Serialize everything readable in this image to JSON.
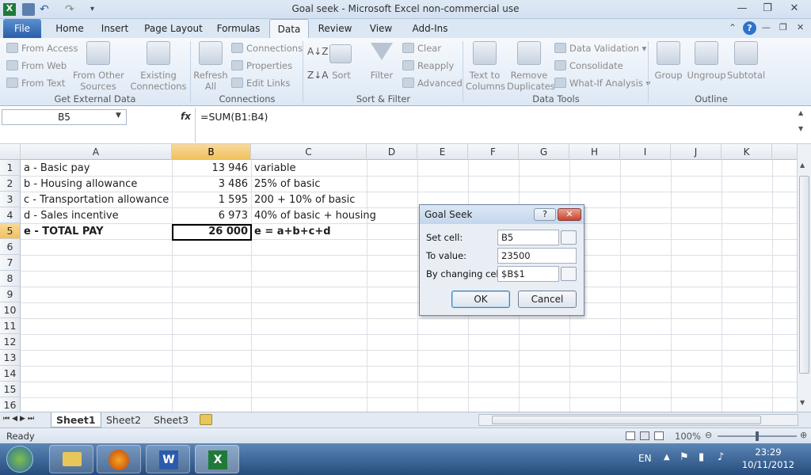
{
  "window": {
    "title": "Goal seek  -  Microsoft Excel non-commercial use"
  },
  "tabs": [
    "File",
    "Home",
    "Insert",
    "Page Layout",
    "Formulas",
    "Data",
    "Review",
    "View",
    "Add-Ins"
  ],
  "ribbon": {
    "get_external": {
      "from_access": "From Access",
      "from_web": "From Web",
      "from_text": "From Text",
      "from_other_1": "From Other",
      "from_other_2": "Sources",
      "existing_1": "Existing",
      "existing_2": "Connections",
      "group": "Get External Data"
    },
    "connections": {
      "refresh_1": "Refresh",
      "refresh_2": "All",
      "connections": "Connections",
      "properties": "Properties",
      "edit_links": "Edit Links",
      "group": "Connections"
    },
    "sort_filter": {
      "sort": "Sort",
      "filter": "Filter",
      "clear": "Clear",
      "reapply": "Reapply",
      "advanced": "Advanced",
      "group": "Sort & Filter"
    },
    "data_tools": {
      "ttc_1": "Text to",
      "ttc_2": "Columns",
      "rd_1": "Remove",
      "rd_2": "Duplicates",
      "validation": "Data Validation",
      "consolidate": "Consolidate",
      "whatif": "What-If Analysis",
      "group": "Data Tools"
    },
    "outline": {
      "group_btn": "Group",
      "ungroup": "Ungroup",
      "subtotal": "Subtotal",
      "group": "Outline"
    }
  },
  "formula_bar": {
    "name_box": "B5",
    "fx": "fx",
    "formula": "=SUM(B1:B4)"
  },
  "columns": [
    "A",
    "B",
    "C",
    "D",
    "E",
    "F",
    "G",
    "H",
    "I",
    "J",
    "K"
  ],
  "rows": [
    "1",
    "2",
    "3",
    "4",
    "5",
    "6",
    "7",
    "8",
    "9",
    "10",
    "11",
    "12",
    "13",
    "14",
    "15",
    "16"
  ],
  "cells": [
    {
      "a": "a - Basic pay",
      "b": "13 946",
      "c": "variable"
    },
    {
      "a": "b - Housing allowance",
      "b": "3 486",
      "c": "25% of basic"
    },
    {
      "a": "c - Transportation allowance",
      "b": "1 595",
      "c": "200 + 10% of basic"
    },
    {
      "a": "d - Sales incentive",
      "b": "6 973",
      "c": "40% of basic + housing"
    },
    {
      "a": "e - TOTAL PAY",
      "b": "26 000",
      "c": "e = a+b+c+d"
    }
  ],
  "sheets": [
    "Sheet1",
    "Sheet2",
    "Sheet3"
  ],
  "status": {
    "ready": "Ready",
    "zoom": "100%"
  },
  "dialog": {
    "title": "Goal Seek",
    "set_cell_label": "Set cell:",
    "set_cell_value": "B5",
    "to_value_label": "To value:",
    "to_value_value": "23500",
    "changing_label": "By changing cell:",
    "changing_value": "$B$1",
    "ok": "OK",
    "cancel": "Cancel",
    "help": "?",
    "close": "✕"
  },
  "taskbar": {
    "lang": "EN",
    "time": "23:29",
    "date": "10/11/2012"
  }
}
